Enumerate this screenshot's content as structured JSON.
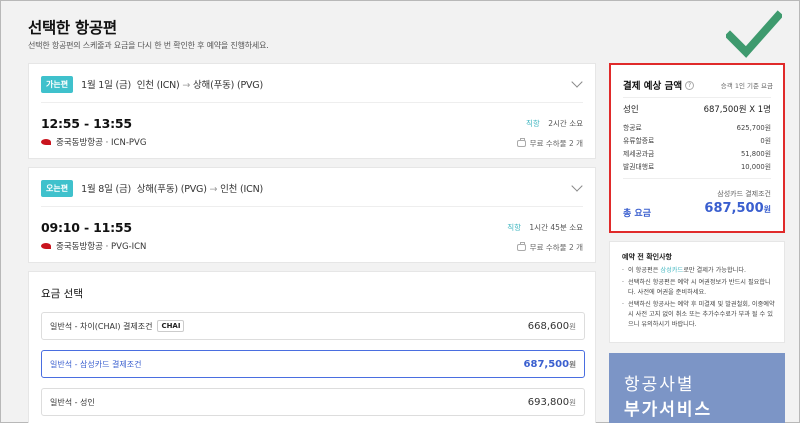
{
  "page": {
    "title": "선택한 항공편",
    "subtitle": "선택한 항공편의 스케줄과 요금을 다시 한 번 확인한 후 예약을 진행하세요."
  },
  "outbound": {
    "badge": "가는편",
    "date": "1월 1일 (금)",
    "origin": "인천 (ICN)",
    "arrow": "→",
    "destination": "상해(푸동) (PVG)",
    "time": "12:55 - 13:55",
    "airline": "중국동방항공 · ICN-PVG",
    "direct": "직항",
    "duration": "2시간 소요",
    "baggage": "무료 수하물 2 개"
  },
  "inbound": {
    "badge": "오는편",
    "date": "1월 8일 (금)",
    "origin": "상해(푸동) (PVG)",
    "arrow": "→",
    "destination": "인천 (ICN)",
    "time": "09:10 - 11:55",
    "airline": "중국동방항공 · PVG-ICN",
    "direct": "직항",
    "duration": "1시간 45분 소요",
    "baggage": "무료 수하물 2 개"
  },
  "fare": {
    "title": "요금 선택",
    "currency_unit": "원",
    "options": [
      {
        "label": "일반석 - 차이(CHAI) 결제조건",
        "logo": "CHAI",
        "amount": "668,600",
        "selected": false
      },
      {
        "label": "일반석 - 삼성카드 결제조건",
        "amount": "687,500",
        "selected": true
      },
      {
        "label": "일반석 - 성인",
        "amount": "693,800",
        "selected": false
      }
    ]
  },
  "summary": {
    "title": "결제 예상 금액",
    "help": "?",
    "basis": "승객 1인 기준 요금",
    "adult_label": "성인",
    "adult_value": "687,500원 X 1명",
    "rows": [
      {
        "label": "항공료",
        "value": "625,700원"
      },
      {
        "label": "유류할증료",
        "value": "0원"
      },
      {
        "label": "제세공과금",
        "value": "51,800원"
      },
      {
        "label": "발권대행료",
        "value": "10,000원"
      }
    ],
    "condition": "삼성카드 결제조건",
    "total_label": "총 요금",
    "total_amount": "687,500",
    "total_unit": "원"
  },
  "notice": {
    "title": "예약 전 확인사항",
    "item1_pre": "이 항공편은 ",
    "item1_hl": "삼성카드",
    "item1_post": "로만 결제가 가능합니다.",
    "item2": "선택하신 항공편은 예약 시 여권정보가 반드시 필요합니다. 사전에 여권을 준비하세요.",
    "item3": "선택하신 항공사는 예약 후 미결제 및 발권철회, 이중예약 시 사전 고지 없이 취소 또는 추가수수료가 부과 될 수 있으니 유의하시기 바랍니다."
  },
  "banner": {
    "line1": "항공사별",
    "line2": "부가서비스"
  },
  "colors": {
    "accent": "#3fc1cc",
    "price_blue": "#3a5fcf",
    "highlight_box": "#e02a2a",
    "checkmark": "#3e9a6e",
    "banner": "#7c95c6"
  }
}
